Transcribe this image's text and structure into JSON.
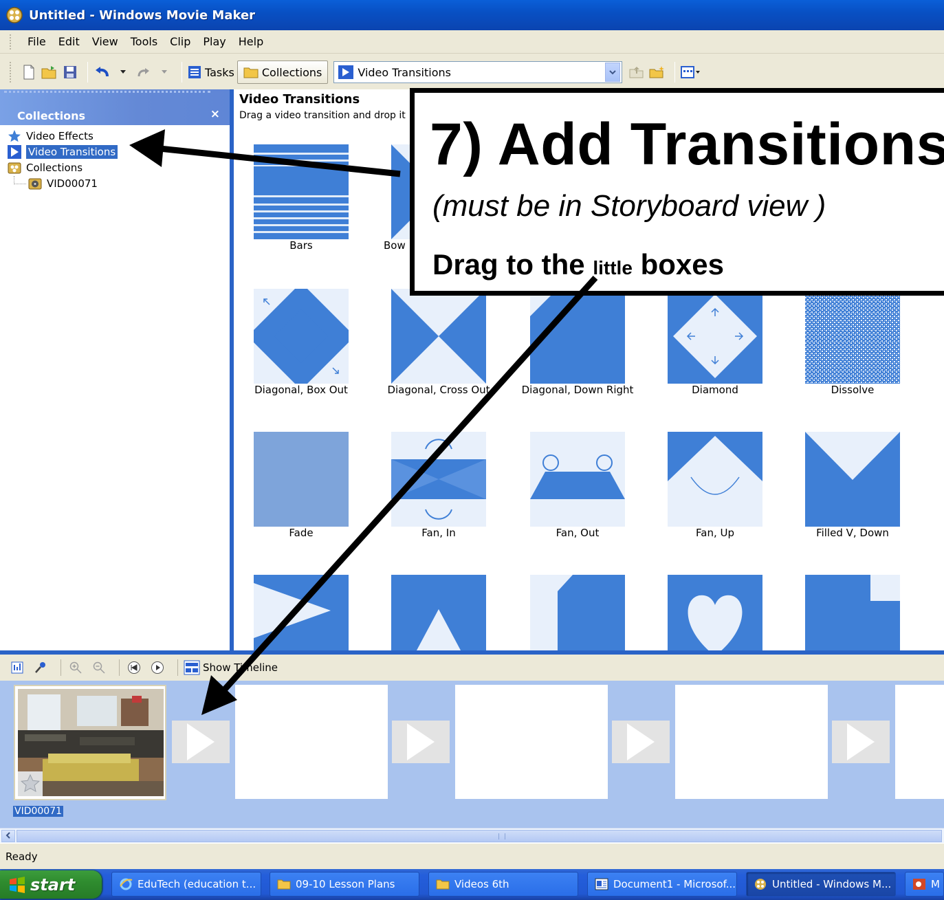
{
  "window": {
    "title": "Untitled - Windows Movie Maker"
  },
  "menu": [
    "File",
    "Edit",
    "View",
    "Tools",
    "Clip",
    "Play",
    "Help"
  ],
  "toolbar": {
    "tasks_label": "Tasks",
    "collections_label": "Collections",
    "location_value": "Video Transitions"
  },
  "left_pane": {
    "title": "Collections",
    "close_symbol": "×",
    "items": [
      {
        "label": "Video Effects",
        "icon": "star-icon"
      },
      {
        "label": "Video Transitions",
        "icon": "transition-icon",
        "selected": true
      },
      {
        "label": "Collections",
        "icon": "collections-icon"
      },
      {
        "label": "VID00071",
        "icon": "film-reel-icon",
        "child": true
      }
    ]
  },
  "content": {
    "title": "Video Transitions",
    "subtitle": "Drag a video transition and drop it be",
    "transitions": [
      {
        "label": "Bars"
      },
      {
        "label": "Bow"
      },
      {
        "label": "Diagonal, Box Out"
      },
      {
        "label": "Diagonal, Cross Out"
      },
      {
        "label": "Diagonal, Down Right"
      },
      {
        "label": "Diamond"
      },
      {
        "label": "Dissolve"
      },
      {
        "label": "Fade"
      },
      {
        "label": "Fan, In"
      },
      {
        "label": "Fan, Out"
      },
      {
        "label": "Fan, Up"
      },
      {
        "label": "Filled V, Down"
      },
      {
        "label": ""
      },
      {
        "label": ""
      },
      {
        "label": ""
      },
      {
        "label": ""
      },
      {
        "label": ""
      }
    ]
  },
  "callout": {
    "heading": "7) Add Transitions",
    "note": "(must be in Storyboard view )",
    "instruction_start": "Drag to the ",
    "instruction_small": "little",
    "instruction_end": " boxes"
  },
  "storyboard_toolbar": {
    "show_timeline_label": "Show Timeline"
  },
  "storyboard": {
    "clip_label": "VID00071"
  },
  "status": {
    "text": "Ready"
  },
  "taskbar": {
    "start_label": "start",
    "items": [
      {
        "label": "EduTech (education t..."
      },
      {
        "label": "09-10 Lesson Plans"
      },
      {
        "label": "Videos 6th"
      },
      {
        "label": "Document1 - Microsof..."
      },
      {
        "label": "Untitled - Windows M...",
        "active": true
      },
      {
        "label": "M"
      }
    ]
  },
  "colors": {
    "xp_blue": "#2a63c7",
    "transition_blue": "#3f7fd6",
    "storyboard_bg": "#a9c3ee"
  }
}
